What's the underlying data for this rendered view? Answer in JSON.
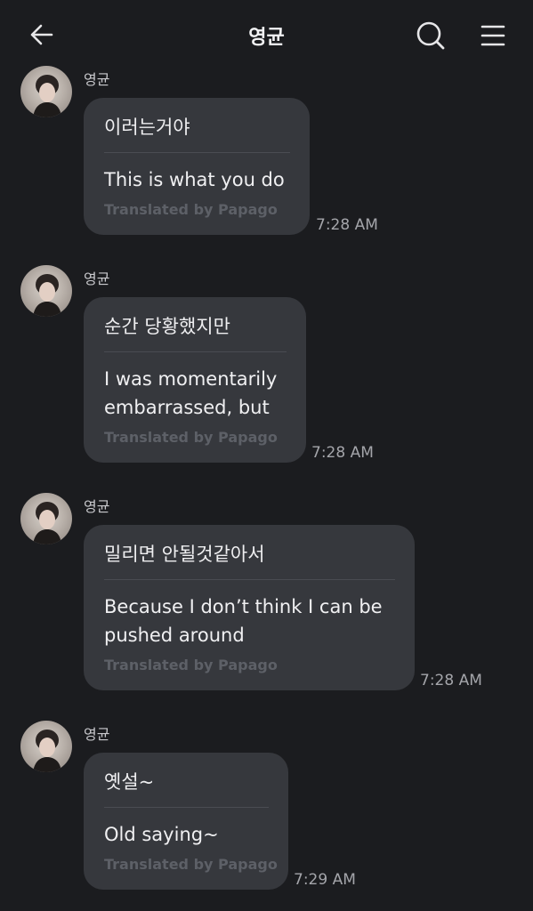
{
  "header": {
    "title": "영균"
  },
  "messages": [
    {
      "sender": "영균",
      "original": "이러는거야",
      "translation": "This is what you do",
      "translated_by": "Translated by Papago",
      "time": "7:28 AM"
    },
    {
      "sender": "영균",
      "original": "순간 당황했지만",
      "translation": "I was momentarily embarrassed, but",
      "translated_by": "Translated by Papago",
      "time": "7:28 AM"
    },
    {
      "sender": "영균",
      "original": "밀리면 안될것같아서",
      "translation": "Because I don’t think I can be pushed around",
      "translated_by": "Translated by Papago",
      "time": "7:28 AM"
    },
    {
      "sender": "영균",
      "original": "옛설~",
      "translation": "Old saying~",
      "translated_by": "Translated by Papago",
      "time": "7:29 AM"
    }
  ],
  "icons": {
    "back": "arrow-left-icon",
    "search": "search-icon",
    "menu": "hamburger-menu-icon"
  },
  "colors": {
    "background": "#1b1c1f",
    "bubble": "#36383d",
    "text": "#eeeef0",
    "muted": "#5d6067",
    "timestamp": "#a4a5aa"
  }
}
